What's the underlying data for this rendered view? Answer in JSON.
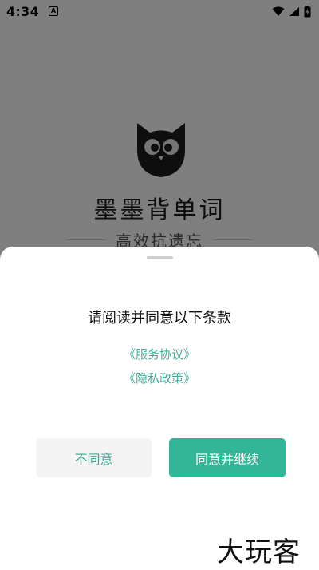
{
  "status_bar": {
    "time": "4:34",
    "notification_icon": "a-icon",
    "icons": [
      "wifi-icon",
      "signal-icon",
      "battery-icon"
    ]
  },
  "splash": {
    "logo_icon": "owl-logo-icon",
    "app_name": "墨墨背单词",
    "slogan": "高效抗遗忘"
  },
  "dialog": {
    "title": "请阅读并同意以下条款",
    "links": [
      "《服务协议》",
      "《隐私政策》"
    ],
    "disagree_label": "不同意",
    "agree_label": "同意并继续"
  },
  "watermark": "大玩客",
  "colors": {
    "accent": "#33b697",
    "link": "#3fae98",
    "secondary_button_bg": "#f4f4f4"
  }
}
